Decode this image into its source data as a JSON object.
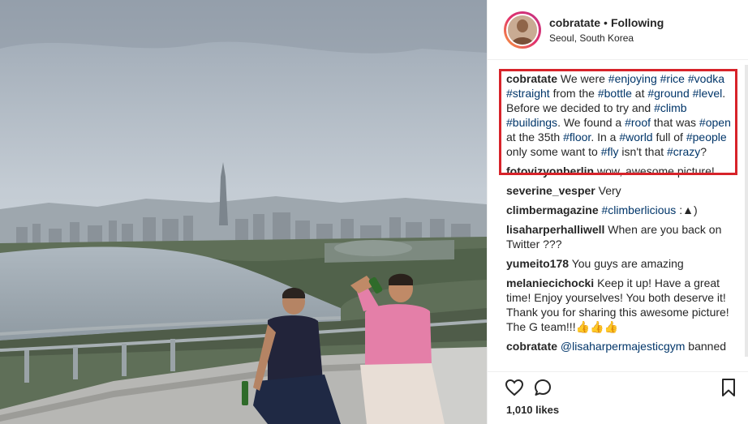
{
  "header": {
    "username": "cobratate",
    "separator": "•",
    "follow_status": "Following",
    "location": "Seoul, South Korea"
  },
  "caption": {
    "username": "cobratate",
    "parts": [
      {
        "t": "We were ",
        "tag": false
      },
      {
        "t": "#enjoying",
        "tag": true
      },
      {
        "t": " ",
        "tag": false
      },
      {
        "t": "#rice",
        "tag": true
      },
      {
        "t": " ",
        "tag": false
      },
      {
        "t": "#vodka",
        "tag": true
      },
      {
        "t": " ",
        "tag": false
      },
      {
        "t": "#straight",
        "tag": true
      },
      {
        "t": " from the ",
        "tag": false
      },
      {
        "t": "#bottle",
        "tag": true
      },
      {
        "t": " at ",
        "tag": false
      },
      {
        "t": "#ground",
        "tag": true
      },
      {
        "t": " ",
        "tag": false
      },
      {
        "t": "#level",
        "tag": true
      },
      {
        "t": ". Before we decided to try and ",
        "tag": false
      },
      {
        "t": "#climb",
        "tag": true
      },
      {
        "t": " ",
        "tag": false
      },
      {
        "t": "#buildings",
        "tag": true
      },
      {
        "t": ". We found a ",
        "tag": false
      },
      {
        "t": "#roof",
        "tag": true
      },
      {
        "t": " that was ",
        "tag": false
      },
      {
        "t": "#open",
        "tag": true
      },
      {
        "t": " at the 35th ",
        "tag": false
      },
      {
        "t": "#floor",
        "tag": true
      },
      {
        "t": ". In a ",
        "tag": false
      },
      {
        "t": "#world",
        "tag": true
      },
      {
        "t": " full of ",
        "tag": false
      },
      {
        "t": "#people",
        "tag": true
      },
      {
        "t": " only some want to ",
        "tag": false
      },
      {
        "t": "#fly",
        "tag": true
      },
      {
        "t": " isn't that ",
        "tag": false
      },
      {
        "t": "#crazy",
        "tag": true
      },
      {
        "t": "?",
        "tag": false
      }
    ]
  },
  "comments": [
    {
      "user": "fotovizyonberlin",
      "parts": [
        {
          "t": "wow, awesome picture!",
          "tag": false
        }
      ]
    },
    {
      "user": "severine_vesper",
      "parts": [
        {
          "t": "Very",
          "tag": false
        }
      ]
    },
    {
      "user": "climbermagazine",
      "parts": [
        {
          "t": "#climberlicious",
          "tag": true
        },
        {
          "t": " :▲)",
          "tag": false
        }
      ]
    },
    {
      "user": "lisaharperhalliwell",
      "parts": [
        {
          "t": "When are you back on Twitter ???",
          "tag": false
        }
      ]
    },
    {
      "user": "yumeito178",
      "parts": [
        {
          "t": "You guys are amazing",
          "tag": false
        }
      ]
    },
    {
      "user": "melaniecichocki",
      "parts": [
        {
          "t": "Keep it up! Have a great time! Enjoy yourselves! You both deserve it! Thank you for sharing this awesome picture! The G team!!!👍👍👍",
          "tag": false
        }
      ]
    },
    {
      "user": "cobratate",
      "parts": [
        {
          "t": "@lisaharpermajesticgym",
          "tag": true
        },
        {
          "t": " banned",
          "tag": false
        }
      ]
    }
  ],
  "actions": {
    "like_icon": "heart-icon",
    "comment_icon": "comment-icon",
    "save_icon": "bookmark-icon"
  },
  "likes": "1,010 likes",
  "colors": {
    "hashtag": "#003569",
    "highlight_box": "#d7232a"
  }
}
